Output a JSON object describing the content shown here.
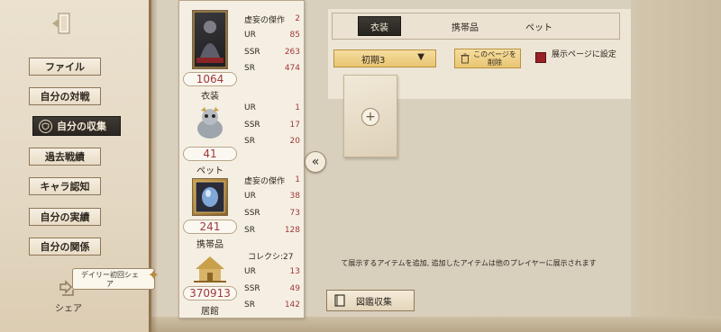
{
  "sidebar": {
    "items": [
      {
        "label": "ファイル"
      },
      {
        "label": "自分の対戦"
      },
      {
        "label": "自分の収集"
      },
      {
        "label": "過去戦績"
      },
      {
        "label": "キャラ認知"
      },
      {
        "label": "自分の実績"
      },
      {
        "label": "自分の関係"
      }
    ],
    "daily_badge": "デイリー初回シェア",
    "share_label": "シェア"
  },
  "stats": {
    "costume": {
      "rows": [
        {
          "label": "虚妄の傑作",
          "value": "2"
        },
        {
          "label": "UR",
          "value": "85"
        },
        {
          "label": "SSR",
          "value": "263"
        },
        {
          "label": "SR",
          "value": "474"
        }
      ],
      "count": "1064",
      "name": "衣装"
    },
    "pet": {
      "rows": [
        {
          "label": "UR",
          "value": "1"
        },
        {
          "label": "SSR",
          "value": "17"
        },
        {
          "label": "SR",
          "value": "20"
        }
      ],
      "count": "41",
      "name": "ペット"
    },
    "accessory": {
      "rows": [
        {
          "label": "虚妄の傑作",
          "value": "1"
        },
        {
          "label": "UR",
          "value": "38"
        },
        {
          "label": "SSR",
          "value": "73"
        },
        {
          "label": "SR",
          "value": "128"
        }
      ],
      "count": "241",
      "name": "携帯品"
    },
    "residence": {
      "header": "コレクシ:27",
      "rows": [
        {
          "label": "UR",
          "value": "13"
        },
        {
          "label": "SSR",
          "value": "49"
        },
        {
          "label": "SR",
          "value": "142"
        }
      ],
      "count": "370913",
      "name": "居館"
    }
  },
  "tabs": [
    {
      "label": "衣装"
    },
    {
      "label": "携帯品"
    },
    {
      "label": "ペット"
    }
  ],
  "filter": {
    "selected": "初期3"
  },
  "delete_page_label": "このページを削除",
  "showcase_label": "展示ページに設定",
  "info_text": "て展示するアイテムを追加, 追加したアイテムは他のプレイヤーに展示されます",
  "catalog_label": "図鑑収集",
  "colors": {
    "accent_red": "#a0383a",
    "tab_dark": "#27241f",
    "gold": "#e8c571"
  }
}
